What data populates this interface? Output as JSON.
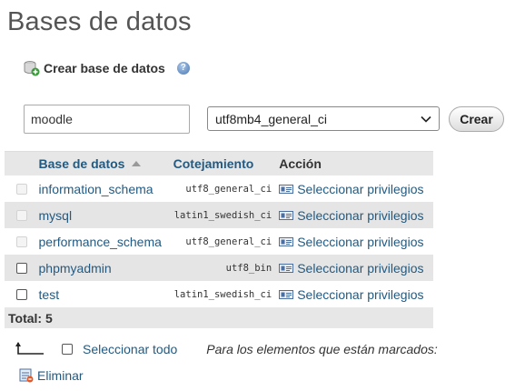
{
  "page": {
    "title": "Bases de datos"
  },
  "create": {
    "header": "Crear base de datos",
    "help_icon": "help-icon",
    "name_value": "moodle",
    "collation_value": "utf8mb4_general_ci",
    "button_label": "Crear"
  },
  "table": {
    "headers": {
      "name": "Base de datos",
      "collation": "Cotejamiento",
      "action": "Acción"
    },
    "rows": [
      {
        "name": "information_schema",
        "collation": "utf8_general_ci",
        "action": "Seleccionar privilegios",
        "selectable": false
      },
      {
        "name": "mysql",
        "collation": "latin1_swedish_ci",
        "action": "Seleccionar privilegios",
        "selectable": false
      },
      {
        "name": "performance_schema",
        "collation": "utf8_general_ci",
        "action": "Seleccionar privilegios",
        "selectable": false
      },
      {
        "name": "phpmyadmin",
        "collation": "utf8_bin",
        "action": "Seleccionar privilegios",
        "selectable": true
      },
      {
        "name": "test",
        "collation": "latin1_swedish_ci",
        "action": "Seleccionar privilegios",
        "selectable": true
      }
    ],
    "total": "Total: 5"
  },
  "bulk": {
    "select_all": "Seleccionar todo",
    "with_selected": "Para los elementos que están marcados:",
    "delete_label": "Eliminar"
  },
  "colors": {
    "link": "#235a81",
    "row_alt": "#e5e5e5",
    "header_bg": "#e7e7e7"
  }
}
